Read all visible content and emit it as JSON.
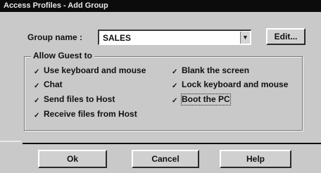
{
  "window": {
    "title": "Access Profiles - Add Group"
  },
  "group_name": {
    "label": "Group name :",
    "value": "SALES",
    "edit_label": "Edit..."
  },
  "permissions": {
    "legend": "Allow Guest to",
    "items": [
      {
        "label": "Use keyboard and mouse",
        "checked": true
      },
      {
        "label": "Chat",
        "checked": true
      },
      {
        "label": "Send files to Host",
        "checked": true
      },
      {
        "label": "Receive files from Host",
        "checked": true
      },
      {
        "label": "Blank the screen",
        "checked": true
      },
      {
        "label": "Lock keyboard and mouse",
        "checked": true
      },
      {
        "label": "Boot the PC",
        "checked": true
      }
    ]
  },
  "buttons": {
    "ok": "Ok",
    "cancel": "Cancel",
    "help": "Help"
  },
  "icons": {
    "checkbox_mark": "checkmark-icon",
    "combo_arrow": "chevron-down-icon"
  }
}
